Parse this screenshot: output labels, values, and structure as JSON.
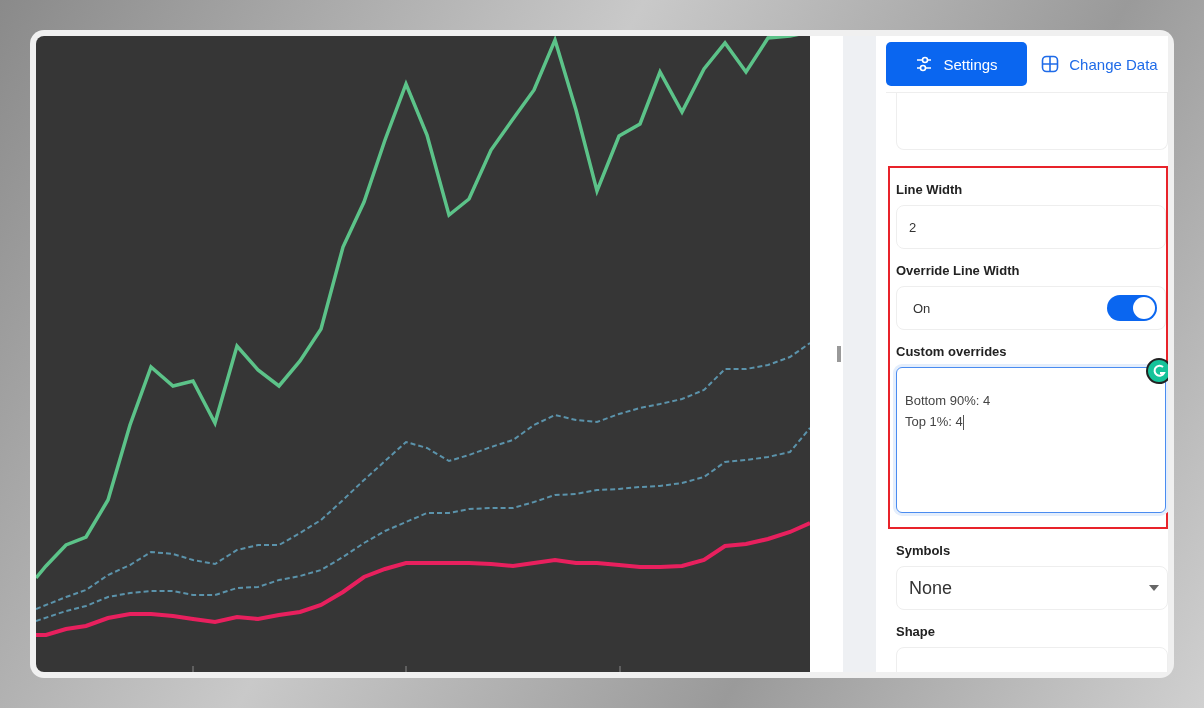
{
  "tabs": [
    {
      "label": "Settings",
      "selected": true
    },
    {
      "label": "Change Data",
      "selected": false
    }
  ],
  "fields_before": [
    {
      "kind": "blank"
    }
  ],
  "highlighted_fields": [
    {
      "kind": "input",
      "label": "Line Width",
      "value": "2"
    },
    {
      "kind": "toggle",
      "label": "Override Line Width",
      "value": "On",
      "on": true
    },
    {
      "kind": "textarea",
      "label": "Custom overrides",
      "lines": [
        "Bottom 90%: 4",
        "Top 1%: 4"
      ],
      "focused": true
    }
  ],
  "fields_after": [
    {
      "kind": "select",
      "label": "Symbols",
      "value": "None"
    },
    {
      "kind": "select",
      "label": "Shape"
    }
  ]
}
